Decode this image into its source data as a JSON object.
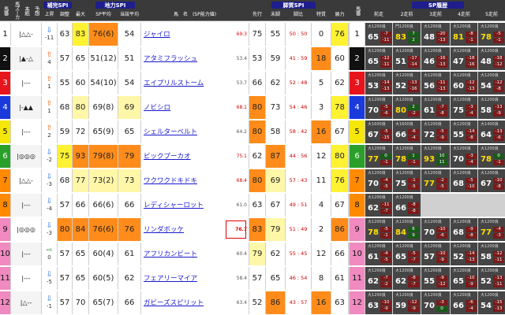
{
  "headers": {
    "group_hosei": "補完SPI",
    "group_chiryoku": "地力SPI",
    "group_kyakushitsu": "脚質SPI",
    "group_sp": "SP履歴",
    "baban": "馬番",
    "marks": "馬ズーカ",
    "kenkai": "本紙",
    "kenkai2": "予想",
    "joushou": "上昇",
    "chousei": "調整",
    "saidai": "最大",
    "sp_heikin": "SP平均",
    "tougai": "当該平均",
    "bamei": "馬　名　(SP能力値)",
    "senko": "先行",
    "matsuashi": "末脚",
    "kyakuhi": "脚比",
    "tokushitsu": "特質",
    "tenryoku": "展力",
    "shinmei": "馬番",
    "past": [
      "前走",
      "2走前",
      "3走前",
      "4走前",
      "5走前"
    ]
  },
  "colors": {
    "frame": [
      "#ffffff",
      "#111111",
      "#e8141c",
      "#1a3adc",
      "#f6e70a",
      "#2aa02a",
      "#ff8a00",
      "#f08ac0"
    ],
    "frame_text": [
      "#111111",
      "#ffffff",
      "#ffffff",
      "#ffffff",
      "#111111",
      "#ffffff",
      "#111111",
      "#111111"
    ],
    "orange": "#ff8c1a",
    "yellow": "#fff233",
    "lightyellow": "#fff7a8",
    "white": "#ffffff",
    "gray": "#d8d8d8",
    "rowgray": "#e9e9e9"
  },
  "rows": [
    {
      "no": "1",
      "frame": 0,
      "marks": "|△△-",
      "trend": "-11",
      "trend_dir": "down",
      "chousei": "63",
      "saidai": "83",
      "sp": "76(6)",
      "tougai": "54",
      "name": "ジャイロ",
      "rating": "69.3",
      "rating_red": true,
      "senko": "75",
      "matsu": "55",
      "kyakuhi": "50 : 50",
      "toku": "0",
      "ten": "76",
      "cols": {
        "chousei": "white",
        "saidai": "yellow",
        "sp": "orange",
        "tougai": "white",
        "senko": "white",
        "matsu": "white",
        "toku": "white",
        "ten": "yellow"
      },
      "past": [
        {
          "top": "大1200良",
          "big": "65",
          "a": "-7",
          "b": "-11",
          "gd": false
        },
        {
          "top": "門1200良",
          "big": "83",
          "a": "7",
          "b": "2",
          "gd": true
        },
        {
          "top": "大1200良",
          "big": "48",
          "a": "-20",
          "b": "-13",
          "gd": false
        },
        {
          "top": "大1200良",
          "big": "81",
          "a": "-8",
          "b": "-1",
          "gd": true
        },
        {
          "top": "大1200良",
          "big": "78",
          "a": "-5",
          "b": "-1",
          "gd": true
        }
      ]
    },
    {
      "no": "2",
      "frame": 1,
      "marks": "|▲-△",
      "trend": "4",
      "trend_dir": "up",
      "chousei": "57",
      "saidai": "65",
      "sp": "51(12)",
      "tougai": "51",
      "name": "アタミフラッシュ",
      "rating": "53.4",
      "rating_red": false,
      "senko": "53",
      "matsu": "59",
      "kyakuhi": "41 : 59",
      "toku": "18",
      "ten": "60",
      "cols": {
        "chousei": "white",
        "saidai": "white",
        "sp": "white",
        "tougai": "white",
        "senko": "white",
        "matsu": "white",
        "toku": "orange",
        "ten": "white"
      },
      "past": [
        {
          "top": "大1200良",
          "big": "65",
          "a": "-12",
          "b": "-11",
          "gd": false
        },
        {
          "top": "大1200良",
          "big": "51",
          "a": "-17",
          "b": "-14",
          "gd": false
        },
        {
          "top": "大1200良",
          "big": "46",
          "a": "-16",
          "b": "-13",
          "gd": false
        },
        {
          "top": "大1200良",
          "big": "47",
          "a": "-18",
          "b": "-16",
          "gd": false
        },
        {
          "top": "大1200良",
          "big": "48",
          "a": "-18",
          "b": "-12",
          "gd": false
        }
      ]
    },
    {
      "no": "3",
      "frame": 2,
      "marks": "|---",
      "trend": "1",
      "trend_dir": "up",
      "chousei": "55",
      "saidai": "60",
      "sp": "54(10)",
      "tougai": "54",
      "name": "エイプリルストーム",
      "rating": "53.7",
      "rating_red": false,
      "senko": "66",
      "matsu": "62",
      "kyakuhi": "52 : 48",
      "toku": "5",
      "ten": "62",
      "cols": {
        "chousei": "white",
        "saidai": "white",
        "sp": "white",
        "tougai": "white",
        "senko": "white",
        "matsu": "white",
        "toku": "white",
        "ten": "white"
      },
      "past": [
        {
          "top": "大1200良",
          "big": "53",
          "a": "-14",
          "b": "-13",
          "gd": false
        },
        {
          "top": "大1200良",
          "big": "52",
          "a": "-13",
          "b": "-16",
          "gd": false
        },
        {
          "top": "大1200良",
          "big": "56",
          "a": "-11",
          "b": "-13",
          "gd": false
        },
        {
          "top": "大1200良",
          "big": "60",
          "a": "-12",
          "b": "-13",
          "gd": false
        },
        {
          "top": "大1200良",
          "big": "54",
          "a": "-12",
          "b": "-8",
          "gd": false
        }
      ]
    },
    {
      "no": "4",
      "frame": 3,
      "marks": "|-▲▲",
      "trend": "1",
      "trend_dir": "up",
      "chousei": "68",
      "saidai": "80",
      "sp": "69(8)",
      "tougai": "69",
      "name": "ノビシロ",
      "rating": "68.1",
      "rating_red": true,
      "senko": "80",
      "matsu": "73",
      "kyakuhi": "54 : 46",
      "toku": "3",
      "ten": "78",
      "cols": {
        "chousei": "white",
        "saidai": "lightyellow",
        "sp": "white",
        "tougai": "lightyellow",
        "senko": "orange",
        "matsu": "white",
        "toku": "white",
        "ten": "yellow"
      },
      "past": [
        {
          "top": "大1200良",
          "big": "70",
          "a": "-5",
          "b": "-6",
          "gd": false
        },
        {
          "top": "大1200良",
          "big": "80",
          "a": "2",
          "b": "-2",
          "gd": true
        },
        {
          "top": "大1200良",
          "big": "61",
          "a": "-7",
          "b": "-8",
          "gd": false
        },
        {
          "top": "大1200良",
          "big": "75",
          "a": "-3",
          "b": "-4",
          "gd": false
        },
        {
          "top": "大1200良",
          "big": "58",
          "a": "-13",
          "b": "-9",
          "gd": false
        }
      ]
    },
    {
      "no": "5",
      "frame": 4,
      "marks": "|---",
      "trend": "2",
      "trend_dir": "up",
      "chousei": "59",
      "saidai": "72",
      "sp": "65(9)",
      "tougai": "65",
      "name": "シェルターベルト",
      "rating": "64.2",
      "rating_red": false,
      "senko": "80",
      "matsu": "58",
      "kyakuhi": "58 : 42",
      "toku": "16",
      "ten": "67",
      "cols": {
        "chousei": "white",
        "saidai": "white",
        "sp": "white",
        "tougai": "white",
        "senko": "orange",
        "matsu": "white",
        "toku": "orange",
        "ten": "white"
      },
      "past": [
        {
          "top": "大1600良",
          "big": "67",
          "a": "-5",
          "b": "-15",
          "gd": false
        },
        {
          "top": "大1600良",
          "big": "66",
          "a": "-6",
          "b": "-4",
          "gd": false
        },
        {
          "top": "大1200良",
          "big": "72",
          "a": "-5",
          "b": "-9",
          "gd": false
        },
        {
          "top": "大1200良",
          "big": "55",
          "a": "-14",
          "b": "-8",
          "gd": false
        },
        {
          "top": "大1400良",
          "big": "64",
          "a": "-13",
          "b": "-6",
          "gd": false
        }
      ]
    },
    {
      "no": "6",
      "frame": 5,
      "marks": "|◎◎◎",
      "trend": "-2",
      "trend_dir": "down",
      "chousei": "75",
      "saidai": "93",
      "sp": "79(8)",
      "tougai": "79",
      "name": "ビックプーカオ",
      "rating": "75.1",
      "rating_red": true,
      "senko": "62",
      "matsu": "87",
      "kyakuhi": "44 : 56",
      "toku": "12",
      "ten": "80",
      "cols": {
        "chousei": "yellow",
        "saidai": "orange",
        "sp": "orange",
        "tougai": "orange",
        "senko": "white",
        "matsu": "orange",
        "toku": "white",
        "ten": "yellow"
      },
      "past": [
        {
          "top": "大1200良",
          "big": "77",
          "a": "0",
          "b": "-1",
          "gd": true
        },
        {
          "top": "大1200良",
          "big": "78",
          "a": "1",
          "b": "-1",
          "gd": true
        },
        {
          "top": "大1200良",
          "big": "93",
          "a": "10",
          "b": "11",
          "gd": true
        },
        {
          "top": "大1200良",
          "big": "70",
          "a": "-3",
          "b": "-4",
          "gd": false
        },
        {
          "top": "大1200良",
          "big": "78",
          "a": "0",
          "b": "-1",
          "gd": true
        }
      ]
    },
    {
      "no": "7",
      "frame": 6,
      "marks": "|△△-",
      "trend": "-3",
      "trend_dir": "down",
      "chousei": "68",
      "saidai": "77",
      "sp": "73(2)",
      "tougai": "73",
      "name": "ワクワクドキドキ",
      "rating": "68.4",
      "rating_red": true,
      "senko": "80",
      "matsu": "69",
      "kyakuhi": "57 : 43",
      "toku": "11",
      "ten": "76",
      "cols": {
        "chousei": "white",
        "saidai": "lightyellow",
        "sp": "lightyellow",
        "tougai": "lightyellow",
        "senko": "orange",
        "matsu": "lightyellow",
        "toku": "white",
        "ten": "yellow"
      },
      "past": [
        {
          "top": "大1200良",
          "big": "70",
          "a": "-4",
          "b": "-5",
          "gd": false
        },
        {
          "top": "大1200良",
          "big": "75",
          "a": "-1",
          "b": "-5",
          "gd": false
        },
        {
          "top": "大1200良",
          "big": "77",
          "a": "-2",
          "b": "-5",
          "gd": true
        },
        {
          "top": "大1200良",
          "big": "68",
          "a": "-5",
          "b": "-10",
          "gd": false
        },
        {
          "top": "大1200良",
          "big": "67",
          "a": "-10",
          "b": "-8",
          "gd": false
        }
      ]
    },
    {
      "no": "8",
      "frame": 6,
      "marks": "|---",
      "trend": "-4",
      "trend_dir": "down",
      "chousei": "57",
      "saidai": "66",
      "sp": "66(6)",
      "tougai": "66",
      "name": "レディシャーロット",
      "rating": "61.0",
      "rating_red": false,
      "senko": "63",
      "matsu": "67",
      "kyakuhi": "49 : 51",
      "toku": "4",
      "ten": "67",
      "cols": {
        "chousei": "white",
        "saidai": "white",
        "sp": "white",
        "tougai": "white",
        "senko": "white",
        "matsu": "white",
        "toku": "white",
        "ten": "white"
      },
      "past": [
        {
          "top": "大1200良",
          "big": "62",
          "a": "-11",
          "b": "-7",
          "gd": false
        },
        {
          "top": "大1200良",
          "big": "66",
          "a": "-8",
          "b": "-8",
          "gd": false
        },
        {
          "top": "",
          "big": "",
          "a": "",
          "b": "",
          "gd": false,
          "empty": true
        },
        {
          "top": "",
          "big": "",
          "a": "",
          "b": "",
          "gd": false,
          "empty": true
        },
        {
          "top": "",
          "big": "",
          "a": "",
          "b": "",
          "gd": false,
          "empty": true
        }
      ]
    },
    {
      "no": "9",
      "frame": 7,
      "marks": "|◎◎◎",
      "trend": "-3",
      "trend_dir": "down",
      "chousei": "80",
      "saidai": "84",
      "sp": "76(6)",
      "tougai": "76",
      "name": "リンダボッケ",
      "rating": "76.7",
      "rating_red": true,
      "rating_box": true,
      "senko": "83",
      "matsu": "79",
      "kyakuhi": "51 : 49",
      "toku": "2",
      "ten": "86",
      "cols": {
        "chousei": "orange",
        "saidai": "orange",
        "sp": "orange",
        "tougai": "orange",
        "senko": "orange",
        "matsu": "lightyellow",
        "toku": "white",
        "ten": "orange"
      },
      "past": [
        {
          "top": "大1200良",
          "big": "78",
          "a": "-5",
          "b": "-1",
          "gd": true
        },
        {
          "top": "大1200良",
          "big": "84",
          "a": "6",
          "b": "9",
          "gd": true
        },
        {
          "top": "大1200良",
          "big": "70",
          "a": "-10",
          "b": "-6",
          "gd": false
        },
        {
          "top": "大1200良",
          "big": "68",
          "a": "-9",
          "b": "-8",
          "gd": false
        },
        {
          "top": "大1200良",
          "big": "77",
          "a": "-4",
          "b": "-3",
          "gd": true
        }
      ]
    },
    {
      "no": "10",
      "frame": 7,
      "marks": "|---",
      "trend": "0",
      "trend_dir": "flat",
      "chousei": "57",
      "saidai": "65",
      "sp": "60(4)",
      "tougai": "61",
      "name": "アフリカンビート",
      "rating": "60.4",
      "rating_red": false,
      "senko": "79",
      "matsu": "62",
      "kyakuhi": "55 : 45",
      "toku": "12",
      "ten": "66",
      "cols": {
        "chousei": "white",
        "saidai": "white",
        "sp": "white",
        "tougai": "white",
        "senko": "lightyellow",
        "matsu": "white",
        "toku": "white",
        "ten": "white"
      },
      "past": [
        {
          "top": "大1200良",
          "big": "61",
          "a": "-4",
          "b": "-5",
          "gd": false
        },
        {
          "top": "大1200良",
          "big": "65",
          "a": "-5",
          "b": "-7",
          "gd": false
        },
        {
          "top": "大1200良",
          "big": "57",
          "a": "-10",
          "b": "-9",
          "gd": false
        },
        {
          "top": "大1200良",
          "big": "52",
          "a": "-14",
          "b": "-13",
          "gd": false
        },
        {
          "top": "大1200良",
          "big": "58",
          "a": "-12",
          "b": "-11",
          "gd": false
        }
      ]
    },
    {
      "no": "11",
      "frame": 7,
      "marks": "|---",
      "trend": "-5",
      "trend_dir": "down",
      "chousei": "57",
      "saidai": "65",
      "sp": "60(5)",
      "tougai": "62",
      "name": "フェアリーマイア",
      "rating": "58.4",
      "rating_red": false,
      "senko": "57",
      "matsu": "65",
      "kyakuhi": "46 : 54",
      "toku": "8",
      "ten": "61",
      "cols": {
        "chousei": "white",
        "saidai": "white",
        "sp": "white",
        "tougai": "white",
        "senko": "white",
        "matsu": "white",
        "toku": "white",
        "ten": "white"
      },
      "past": [
        {
          "top": "大1200良",
          "big": "62",
          "a": "-7",
          "b": "-2",
          "gd": false
        },
        {
          "top": "大1200良",
          "big": "62",
          "a": "-8",
          "b": "-7",
          "gd": false
        },
        {
          "top": "大1200良",
          "big": "55",
          "a": "-9",
          "b": "-12",
          "gd": false
        },
        {
          "top": "大1200良",
          "big": "65",
          "a": "-10",
          "b": "-9",
          "gd": false
        },
        {
          "top": "大1200良",
          "big": "52",
          "a": "-13",
          "b": "-11",
          "gd": false
        }
      ]
    },
    {
      "no": "12",
      "frame": 7,
      "marks": "|△--",
      "trend": "-1",
      "trend_dir": "down",
      "chousei": "57",
      "saidai": "70",
      "sp": "65(7)",
      "tougai": "66",
      "name": "ガビーズスピリット",
      "rating": "63.4",
      "rating_red": false,
      "senko": "52",
      "matsu": "86",
      "kyakuhi": "43 : 57",
      "toku": "16",
      "ten": "63",
      "cols": {
        "chousei": "white",
        "saidai": "white",
        "sp": "white",
        "tougai": "white",
        "senko": "white",
        "matsu": "orange",
        "toku": "orange",
        "ten": "white"
      },
      "past": [
        {
          "top": "大1200良",
          "big": "63",
          "a": "-10",
          "b": "-9",
          "gd": false
        },
        {
          "top": "大1200良",
          "big": "59",
          "a": "-12",
          "b": "-9",
          "gd": false
        },
        {
          "top": "大1200良",
          "big": "70",
          "a": "-3",
          "b": "0",
          "gd": false
        },
        {
          "top": "大1200良",
          "big": "66",
          "a": "-6",
          "b": "-4",
          "gd": false
        },
        {
          "top": "大1200良",
          "big": "54",
          "a": "-15",
          "b": "-13",
          "gd": false
        }
      ]
    }
  ]
}
